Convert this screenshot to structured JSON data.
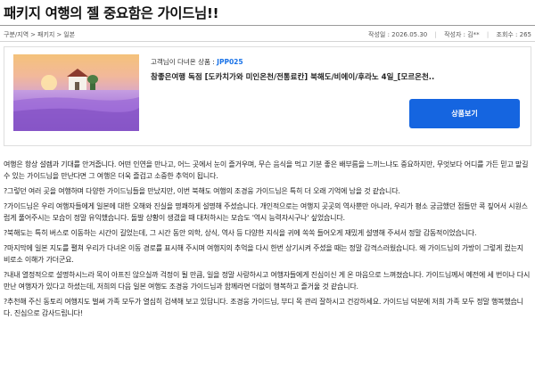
{
  "post": {
    "title": "패키지 여행의 젤 중요함은 가이드님!!",
    "breadcrumb": [
      "구분/지역",
      "패키지",
      "일본"
    ],
    "breadcrumb_separator": ">",
    "date": "작성일 : 2026.05.30",
    "author": "작성자 : 김**",
    "views": "조회수 : 265",
    "meta_divider": "|"
  },
  "product": {
    "code_label": "고객님이 다녀온 상품 :",
    "code_value": "JPP025",
    "name": "참좋은여행 독점 [도카치가와 미인온천/전통료칸] 북해도/비에이/후라노 4일_[모르온천..",
    "button_label": "상품보기",
    "image_icon": "lavender-field-photo",
    "colors": {
      "button": "#1565e0",
      "code": "#1a73e8"
    }
  },
  "review": {
    "paragraphs": [
      " 여행은 항상 설렘과 기대를 안겨줍니다. 어떤 인연을 만나고, 어느 곳에서 눈이 즐거우며, 무슨 음식을 먹고 기분 좋은 배부름을 느끼느냐도 중요하지만, 무엇보다 어디를 가든 믿고 맡길 수 있는 가이드님을 만난다면 그 여행은 더욱 즐겁고 소중한 추억이 됩니다.",
      "?그렇던 여러 곳을 여행하며 다양한 가이드님들을 만났지만, 이번 북해도 여행의 조경웅 가이드님은 특히 더 오래 기억에 남을 것 같습니다.",
      "?가이드님은 우리 여행자들에게 일본에 대한 오해와 진실을 명쾌하게 설명해 주셨습니다. 개인적으로는 여행지 곳곳의 역사뿐만 아니라, 우리가 평소 궁금했던 점들만 콕 짚어서 시원스럽게 풀어주시는 모습이 정말 유익했습니다. 돌발 상황이 생겼을 때 대처하시는 모습도 '역시 능력자시구나' 싶었습니다.",
      "?북해도는 특히 버스로 이동하는 시간이 길었는데, 그 시간 동안 의학, 상식, 역사 등 다양한 지식을 귀에 쏙쏙 들어오게 재밌게 설명해 주셔서 정말 감동적이었습니다.",
      "?마지막에 일본 지도를 펼쳐 우리가 다녀온 이동 경로를 표시해 주시며 여행지의 추억을 다시 한번 상기시켜 주셨을 때는 정말 감격스러웠습니다. 왜 가이드님의 가방이 그렇게 컸는지 비로소 이해가 가더군요.",
      "?내내 열정적으로 설명하시느라 목이 아프진 않으실까 걱정이 될 만큼, 일을 정말 사랑하시고 여행자들에게 진심이신 게 온 마음으로 느껴졌습니다. 가이드님께서 예전에 세 번이나 다시 만난 여행자가 있다고 하셨는데, 저희의 다음 일본 여행도 조경웅 가이드님과 함께라면 더없이 행복하고 즐거울 것 같습니다.",
      "?추천해 주신 동토리 여행지도 벌써 가족 모두가 열심히 검색해 보고 있답니다. 조경웅 가이드님, 부디 목 관리 잘하시고 건강하세요. 가이드님 덕분에 저희 가족 모두 정말 행복했습니다. 진심으로 감사드립니다!"
    ]
  }
}
